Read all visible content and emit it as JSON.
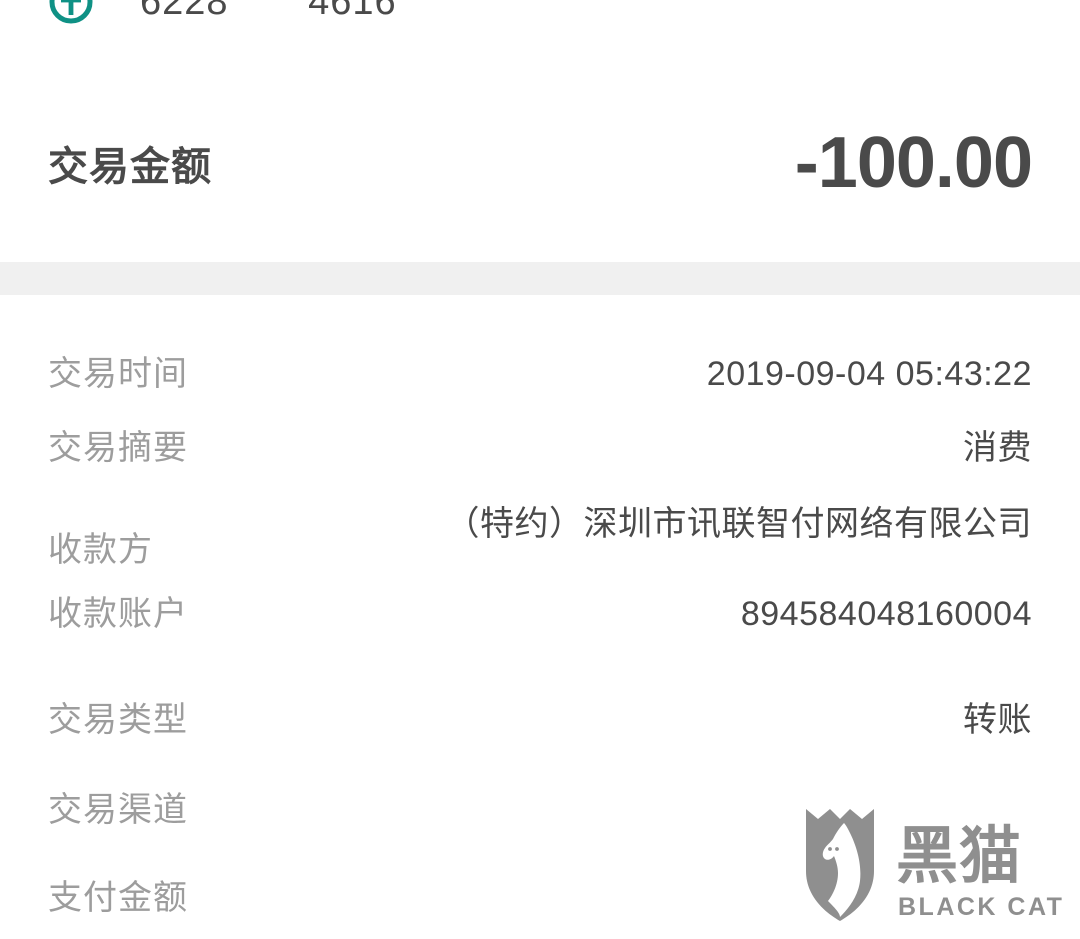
{
  "card_header": {
    "bank_icon": "bank-logo-icon",
    "bank_icon_color": "#0f9185",
    "card_group_1": "6228",
    "card_group_2": "4616"
  },
  "amount": {
    "label": "交易金额",
    "value": "-100.00",
    "color": "#4a4a4a"
  },
  "details": {
    "rows": [
      {
        "label": "交易时间",
        "value": "2019-09-04 05:43:22"
      },
      {
        "label": "交易摘要",
        "value": "消费"
      },
      {
        "label": "收款方",
        "value": "（特约）深圳市讯联智付网络有限公司"
      },
      {
        "label": "收款账户",
        "value": "894584048160004"
      },
      {
        "label": "交易类型",
        "value": "转账"
      },
      {
        "label": "交易渠道",
        "value": ""
      },
      {
        "label": "支付金额",
        "value": ""
      }
    ]
  },
  "watermark": {
    "icon": "black-cat-shield-icon",
    "cn_text": "黑猫",
    "en_text": "BLACK CAT",
    "color": "#8f8f8f"
  },
  "theme": {
    "background": "#ffffff",
    "separator": "#f0f0f0",
    "label_color": "#9d9d9d",
    "value_color": "#4a4a4a"
  }
}
